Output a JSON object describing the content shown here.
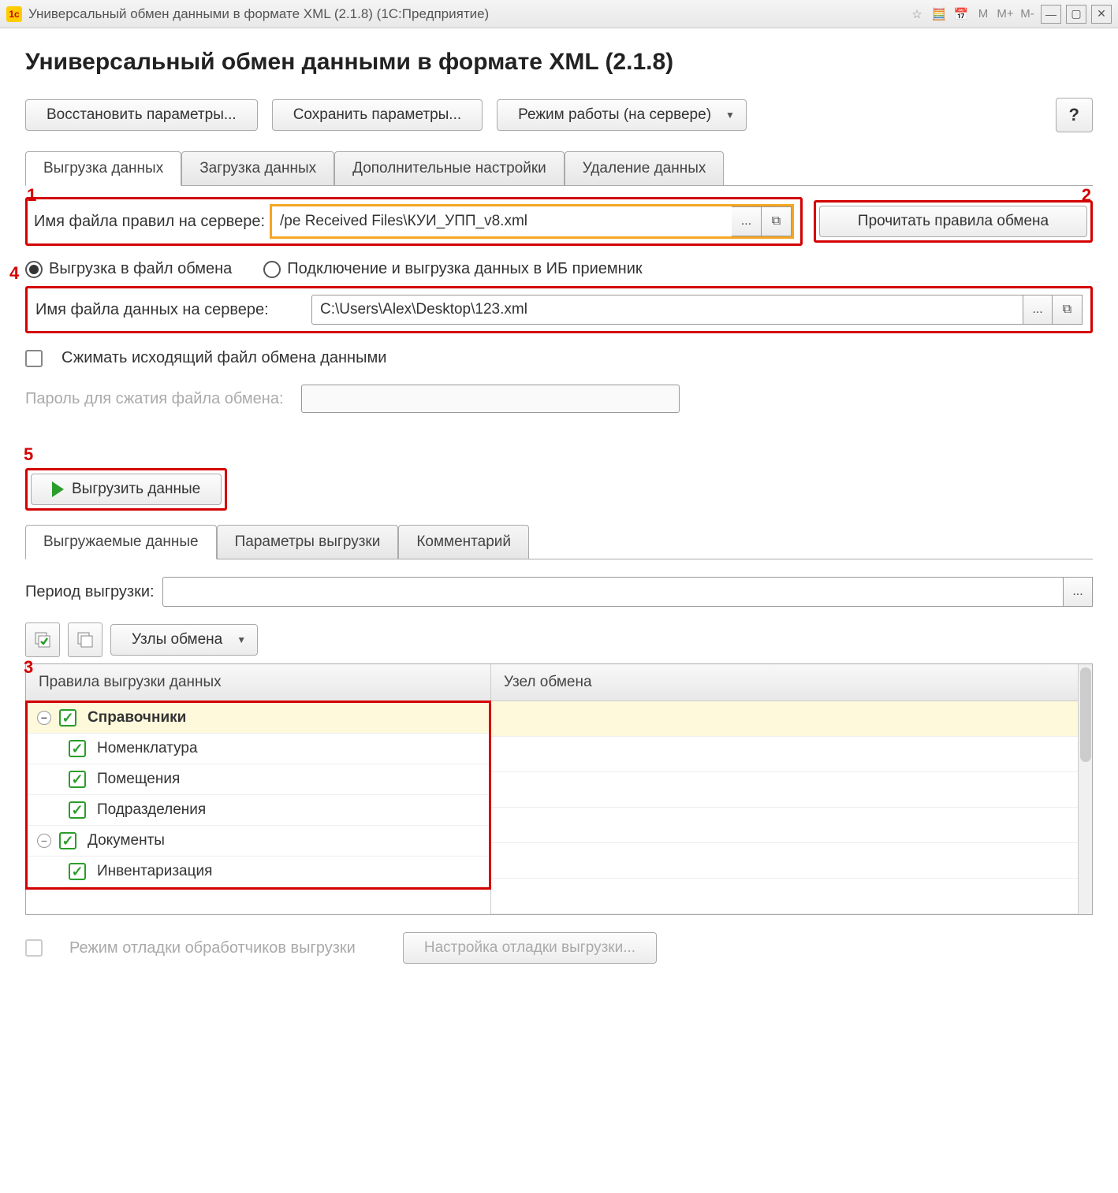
{
  "titlebar": {
    "title": "Универсальный обмен данными в формате XML (2.1.8)  (1С:Предприятие)"
  },
  "header": {
    "title": "Универсальный обмен данными в формате XML (2.1.8)"
  },
  "top_buttons": {
    "restore": "Восстановить параметры...",
    "save": "Сохранить параметры...",
    "mode": "Режим работы (на сервере)",
    "help": "?"
  },
  "tabs": {
    "export": "Выгрузка данных",
    "import": "Загрузка данных",
    "addl": "Дополнительные настройки",
    "delete": "Удаление данных"
  },
  "annotations": {
    "a1": "1",
    "a2": "2",
    "a3": "3",
    "a4": "4",
    "a5": "5"
  },
  "rules_file": {
    "label": "Имя файла правил на сервере:",
    "value": "/pe Received Files\\КУИ_УПП_v8.xml",
    "read_button": "Прочитать правила обмена"
  },
  "radio": {
    "to_file": "Выгрузка в файл обмена",
    "to_ib": "Подключение и выгрузка данных в ИБ приемник"
  },
  "data_file": {
    "label": "Имя файла данных на сервере:",
    "value": "C:\\Users\\Alex\\Desktop\\123.xml"
  },
  "compress": {
    "label": "Сжимать исходящий файл обмена данными"
  },
  "password": {
    "label": "Пароль для сжатия файла обмена:"
  },
  "export_button": "Выгрузить данные",
  "sub_tabs": {
    "data": "Выгружаемые данные",
    "params": "Параметры выгрузки",
    "comment": "Комментарий"
  },
  "period": {
    "label": "Период выгрузки:",
    "value": ""
  },
  "nodes_dropdown": "Узлы обмена",
  "table": {
    "col1": "Правила выгрузки данных",
    "col2": "Узел обмена"
  },
  "tree": {
    "root1": "Справочники",
    "r1c1": "Номенклатура",
    "r1c2": "Помещения",
    "r1c3": "Подразделения",
    "root2": "Документы",
    "r2c1": "Инвентаризация"
  },
  "bottom": {
    "debug_label": "Режим отладки обработчиков выгрузки",
    "debug_button": "Настройка отладки выгрузки..."
  }
}
